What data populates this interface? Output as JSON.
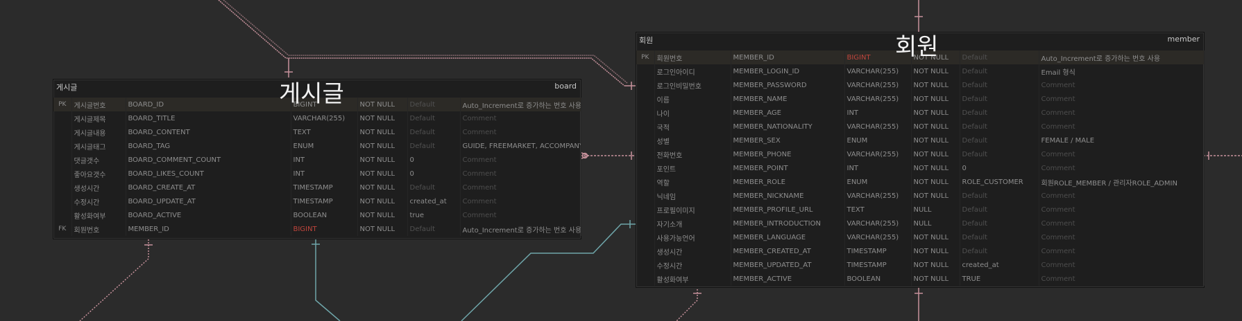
{
  "colors": {
    "background": "#2b2b2b",
    "table_bg": "#1e1e1e",
    "relation_pink": "#c7929c",
    "relation_teal": "#6fa6aa",
    "pk_key": "#d7a53a",
    "fk_type_red": "#c0453c"
  },
  "board": {
    "title_ko": "게시글",
    "header_left": "게시글",
    "header_right": "board",
    "rows": [
      {
        "key": "PK",
        "logical": "게시글번호",
        "physical": "BOARD_ID",
        "type": "BIGINT",
        "nn": "NOT NULL",
        "default": "Default",
        "comment": "Auto_Increment로 증가하는 번호 사용"
      },
      {
        "key": "",
        "logical": "게시글제목",
        "physical": "BOARD_TITLE",
        "type": "VARCHAR(255)",
        "nn": "NOT NULL",
        "default": "Default",
        "comment": "Comment"
      },
      {
        "key": "",
        "logical": "게시글내용",
        "physical": "BOARD_CONTENT",
        "type": "TEXT",
        "nn": "NOT NULL",
        "default": "Default",
        "comment": "Comment"
      },
      {
        "key": "",
        "logical": "게시글태그",
        "physical": "BOARD_TAG",
        "type": "ENUM",
        "nn": "NOT NULL",
        "default": "Default",
        "comment": "GUIDE, FREEMARKET, ACCOMPANY, TIP"
      },
      {
        "key": "",
        "logical": "댓글갯수",
        "physical": "BOARD_COMMENT_COUNT",
        "type": "INT",
        "nn": "NOT NULL",
        "default": "0",
        "comment": "Comment"
      },
      {
        "key": "",
        "logical": "좋아요갯수",
        "physical": "BOARD_LIKES_COUNT",
        "type": "INT",
        "nn": "NOT NULL",
        "default": "0",
        "comment": "Comment"
      },
      {
        "key": "",
        "logical": "생성시간",
        "physical": "BOARD_CREATE_AT",
        "type": "TIMESTAMP",
        "nn": "NOT NULL",
        "default": "Default",
        "comment": "Comment"
      },
      {
        "key": "",
        "logical": "수정시간",
        "physical": "BOARD_UPDATE_AT",
        "type": "TIMESTAMP",
        "nn": "NOT NULL",
        "default": "created_at",
        "comment": "Comment"
      },
      {
        "key": "",
        "logical": "활성화여부",
        "physical": "BOARD_ACTIVE",
        "type": "BOOLEAN",
        "nn": "NOT NULL",
        "default": "true",
        "comment": "Comment"
      },
      {
        "key": "FK",
        "logical": "회원번호",
        "physical": "MEMBER_ID",
        "type": "BIGINT",
        "nn": "NOT NULL",
        "default": "Default",
        "comment": "Auto_Increment로 증가하는 번호 사용"
      }
    ]
  },
  "member": {
    "title_ko": "회원",
    "header_left": "회원",
    "header_right": "member",
    "rows": [
      {
        "key": "PK",
        "logical": "회원번호",
        "physical": "MEMBER_ID",
        "type": "BIGINT",
        "nn": "NOT NULL",
        "default": "Default",
        "comment": "Auto_Increment로 증가하는 번호 사용"
      },
      {
        "key": "",
        "logical": "로그인아이디",
        "physical": "MEMBER_LOGIN_ID",
        "type": "VARCHAR(255)",
        "nn": "NOT NULL",
        "default": "Default",
        "comment": "Email 형식"
      },
      {
        "key": "",
        "logical": "로그인비밀번호",
        "physical": "MEMBER_PASSWORD",
        "type": "VARCHAR(255)",
        "nn": "NOT NULL",
        "default": "Default",
        "comment": "Comment"
      },
      {
        "key": "",
        "logical": "이름",
        "physical": "MEMBER_NAME",
        "type": "VARCHAR(255)",
        "nn": "NOT NULL",
        "default": "Default",
        "comment": "Comment"
      },
      {
        "key": "",
        "logical": "나이",
        "physical": "MEMBER_AGE",
        "type": "INT",
        "nn": "NOT NULL",
        "default": "Default",
        "comment": "Comment"
      },
      {
        "key": "",
        "logical": "국적",
        "physical": "MEMBER_NATIONALITY",
        "type": "VARCHAR(255)",
        "nn": "NOT NULL",
        "default": "Default",
        "comment": "Comment"
      },
      {
        "key": "",
        "logical": "성별",
        "physical": "MEMBER_SEX",
        "type": "ENUM",
        "nn": "NOT NULL",
        "default": "Default",
        "comment": "FEMALE / MALE"
      },
      {
        "key": "",
        "logical": "전화번호",
        "physical": "MEMBER_PHONE",
        "type": "VARCHAR(255)",
        "nn": "NOT NULL",
        "default": "Default",
        "comment": "Comment"
      },
      {
        "key": "",
        "logical": "포인트",
        "physical": "MEMBER_POINT",
        "type": "INT",
        "nn": "NOT NULL",
        "default": "0",
        "comment": "Comment"
      },
      {
        "key": "",
        "logical": "역할",
        "physical": "MEMBER_ROLE",
        "type": "ENUM",
        "nn": "NOT NULL",
        "default": "ROLE_CUSTOMER",
        "comment": "회원ROLE_MEMBER / 관리자ROLE_ADMIN"
      },
      {
        "key": "",
        "logical": "닉네임",
        "physical": "MEMBER_NICKNAME",
        "type": "VARCHAR(255)",
        "nn": "NOT NULL",
        "default": "Default",
        "comment": "Comment"
      },
      {
        "key": "",
        "logical": "프로필이미지",
        "physical": "MEMBER_PROFILE_URL",
        "type": "TEXT",
        "nn": "NULL",
        "default": "Default",
        "comment": "Comment"
      },
      {
        "key": "",
        "logical": "자기소개",
        "physical": "MEMBER_INTRODUCTION",
        "type": "VARCHAR(255)",
        "nn": "NULL",
        "default": "Default",
        "comment": "Comment"
      },
      {
        "key": "",
        "logical": "사용가능언어",
        "physical": "MEMBER_LANGUAGE",
        "type": "VARCHAR(255)",
        "nn": "NOT NULL",
        "default": "Default",
        "comment": "Comment"
      },
      {
        "key": "",
        "logical": "생성시간",
        "physical": "MEMBER_CREATED_AT",
        "type": "TIMESTAMP",
        "nn": "NOT NULL",
        "default": "Default",
        "comment": "Comment"
      },
      {
        "key": "",
        "logical": "수정시간",
        "physical": "MEMBER_UPDATED_AT",
        "type": "TIMESTAMP",
        "nn": "NOT NULL",
        "default": "created_at",
        "comment": "Comment"
      },
      {
        "key": "",
        "logical": "활성화여부",
        "physical": "MEMBER_ACTIVE",
        "type": "BOOLEAN",
        "nn": "NOT NULL",
        "default": "TRUE",
        "comment": "Comment"
      }
    ]
  }
}
